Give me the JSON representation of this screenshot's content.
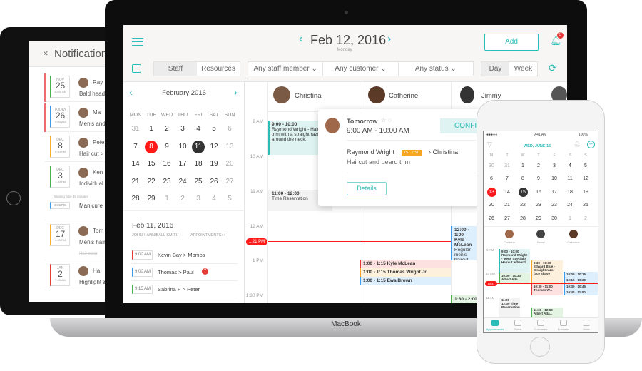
{
  "tablet": {
    "title": "Notification",
    "items": [
      {
        "month": "NOV",
        "day": "25",
        "time": "10:30 AM",
        "name": "Ray",
        "desc": "Bald head",
        "color": "#4caf50",
        "alert": true
      },
      {
        "month": "TODAY",
        "day": "26",
        "time": "9:00 AM",
        "name": "Ma",
        "desc": "Men's and",
        "color": "#3d9be9",
        "alert": true
      },
      {
        "month": "DEC",
        "day": "8",
        "time": "5:30 PM",
        "name": "Pete",
        "desc": "Hair cut >",
        "color": "#f5b02e",
        "alert": false
      },
      {
        "month": "DEC",
        "day": "3",
        "time": "1:30 PM",
        "name": "Ken",
        "desc": "Individual",
        "color": "#4caf50",
        "alert": false,
        "wait": "Waiting time 45 minutes",
        "sub_time": "3:15 PM",
        "sub_desc": "Manicure"
      },
      {
        "month": "DEC",
        "day": "17",
        "time": "4:35 PM",
        "name": "Tom",
        "desc": "Men's hair",
        "color": "#f5b02e",
        "alert": false,
        "sub_desc": "Hair color"
      },
      {
        "month": "JAN",
        "day": "2",
        "time": "7:45 AM",
        "name": "Ha",
        "desc": "Highlight &",
        "color": "#e53935",
        "alert": false
      }
    ]
  },
  "header": {
    "date": "Feb 12, 2016",
    "weekday": "Monday",
    "add": "Add",
    "notif_count": "3"
  },
  "filters": {
    "staff": "Staff",
    "resources": "Resources",
    "staff_member": "Any staff member",
    "customer": "Any customer",
    "status": "Any status",
    "day": "Day",
    "week": "Week"
  },
  "mini_cal": {
    "title": "February 2016",
    "weekdays": [
      "MON",
      "TUE",
      "WED",
      "THU",
      "FRI",
      "SAT",
      "SUN"
    ],
    "rows": [
      [
        "31",
        "1",
        "2",
        "3",
        "4",
        "5",
        "6"
      ],
      [
        "7",
        "8",
        "9",
        "10",
        "11",
        "12",
        "13"
      ],
      [
        "14",
        "15",
        "16",
        "17",
        "18",
        "19",
        "20"
      ],
      [
        "21",
        "22",
        "23",
        "24",
        "25",
        "26",
        "27"
      ],
      [
        "28",
        "29",
        "1",
        "2",
        "3",
        "4",
        "5"
      ]
    ],
    "today": "8",
    "selected": "11"
  },
  "day_list": {
    "date": "Feb 11, 2016",
    "staff": "JOHN HANNIBALL SMITH",
    "appointments": "APPOINTMENTS: 4",
    "rows": [
      {
        "time": "9:00 AM",
        "from": "Kevin Bay",
        "to": "Monica",
        "color": "#e53935"
      },
      {
        "time": "9:00 AM",
        "from": "Thomas",
        "to": "Paul",
        "color": "#3d9be9",
        "flag": "?"
      },
      {
        "time": "9:15 AM",
        "from": "Sabrina F",
        "to": "Peter",
        "color": "#4caf50"
      }
    ]
  },
  "staff": [
    "Christina",
    "Catherine",
    "Jimmy"
  ],
  "hours": [
    "9 AM",
    "10 AM",
    "11 AM",
    "12 AM",
    "1 PM",
    "1:30 PM"
  ],
  "now": "1:21 PM",
  "events": {
    "e1_time": "9:00 - 10:00",
    "e1_text": "Raymond Wright - Haircut trim with a straight razor around the neck.",
    "e2_time": "11:00 - 12:00",
    "e2_text": "Time Reservation",
    "e3": "1:00 - 1:15 Kyle McLean",
    "e4": "1:00 - 1:15 Thomas Wright Jr.",
    "e5": "1:00 - 1:15 Ewa Brown",
    "e6_time": "12:00 - 1:00",
    "e6_name": "Kyle McLean",
    "e6_text": "Regular men's haircut",
    "e7": "1:30 - 2:00"
  },
  "popup": {
    "when": "Tomorrow",
    "time": "9:00 AM - 10:00 AM",
    "confirm": "CONFIRM",
    "client": "Raymond Wright",
    "badge": "1ST VISIT",
    "staff": "Christina",
    "service": "Haircut and beard trim",
    "details": "Details"
  },
  "laptop_brand": "MacBook",
  "phone": {
    "clock": "9:41 AM",
    "battery": "100%",
    "date": "WED, JUNE 15",
    "weekdays": [
      "M",
      "T",
      "W",
      "T",
      "F",
      "S",
      "S"
    ],
    "rows": [
      [
        "30",
        "31",
        "1",
        "2",
        "3",
        "4",
        "5"
      ],
      [
        "6",
        "7",
        "8",
        "9",
        "10",
        "11",
        "12"
      ],
      [
        "13",
        "14",
        "15",
        "16",
        "17",
        "18",
        "19"
      ],
      [
        "20",
        "21",
        "22",
        "23",
        "23",
        "24",
        "25"
      ],
      [
        "26",
        "27",
        "28",
        "29",
        "30",
        "1",
        "2"
      ]
    ],
    "today": "13",
    "selected": "15",
    "staff": [
      "Christina",
      "Jimmy",
      "Catherine"
    ],
    "hours": [
      "9 AM",
      "10 AM",
      "11 AM"
    ],
    "now": "10:31",
    "events": [
      "9:00 - 10:00 Raymond Wright - Mens Specialty Haircut w/beard",
      "10:00 - 10:30 Albert Ada...",
      "9:30 - 10:30 Edward Blue - Straight razor face shave",
      "10:30 - 11:00 Thomas W...",
      "10:00 - 10:15",
      "10:15 - 10:30",
      "10:30 - 10:45",
      "10:45 - 11:00",
      "11:00 - 12:00 Time Reservation",
      "11:30 - 12:00 Albert Ada..."
    ],
    "tabs": [
      "Appointments",
      "Sales",
      "Customers",
      "Business",
      "More"
    ]
  },
  "colors": {
    "accent": "#2bbcb8",
    "now": "#ff1a1a"
  }
}
